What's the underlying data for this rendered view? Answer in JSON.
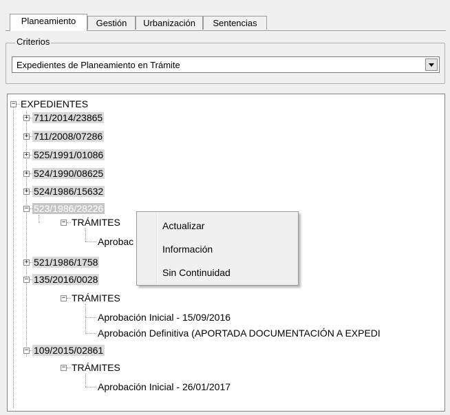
{
  "tabs": [
    "Planeamiento",
    "Gestión",
    "Urbanización",
    "Sentencias"
  ],
  "criteria": {
    "legend": "Criterios",
    "selected": "Expedientes de Planeamiento en Trámite"
  },
  "tree": {
    "root": "EXPEDIENTES",
    "nodes": [
      "711/2014/23865",
      "711/2008/07286",
      "525/1991/01086",
      "524/1990/08625",
      "524/1986/15632",
      "523/1986/28226",
      "TRÁMITES",
      "Aprobac",
      "521/1986/1758",
      "135/2016/0028",
      "TRÁMITES",
      "Aprobación Inicial - 15/09/2016",
      "Aprobación Definitiva (APORTADA DOCUMENTACIÓN A EXPEDI",
      "109/2015/02861",
      "TRÁMITES",
      "Aprobación Inicial - 26/01/2017"
    ]
  },
  "context_menu": {
    "items": [
      "Actualizar",
      "Información",
      "Sin Continuidad"
    ]
  }
}
